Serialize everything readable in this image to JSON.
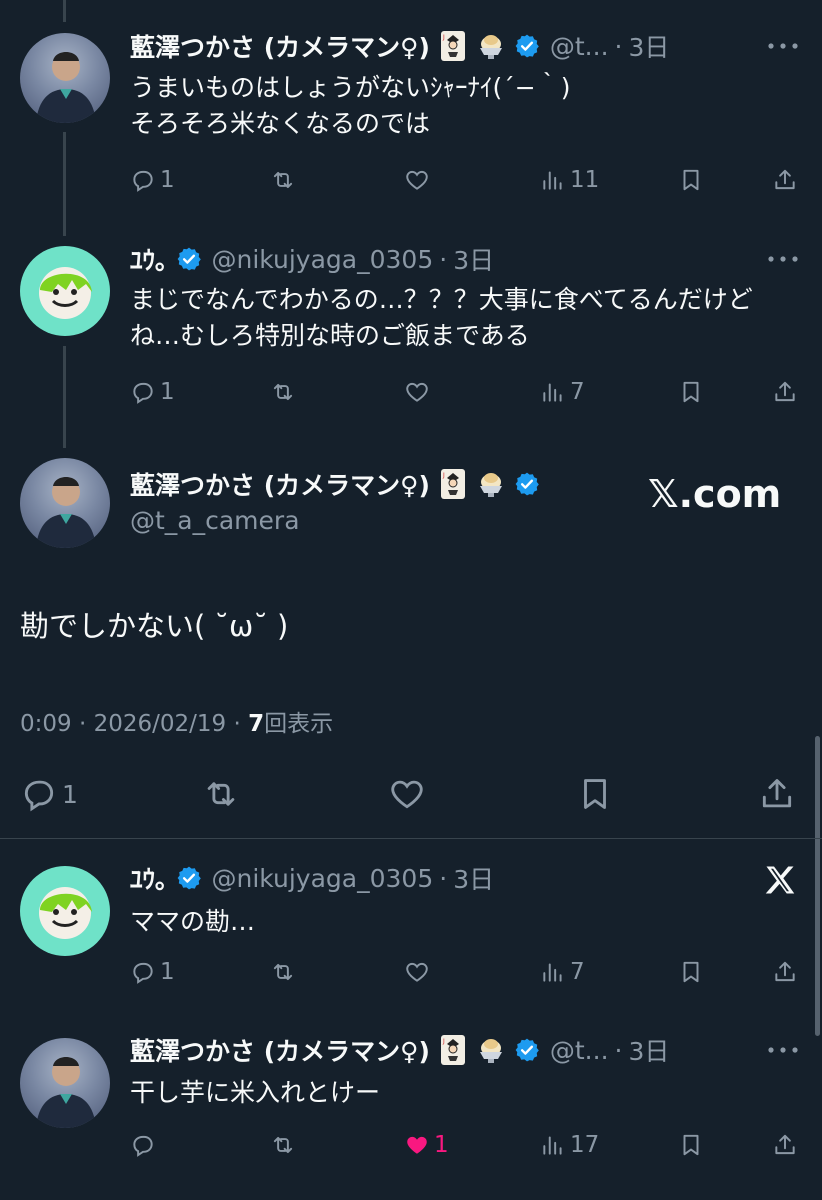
{
  "colors": {
    "background": "#15202b",
    "text": "#f7f9f9",
    "muted": "#8b98a5",
    "verified": "#1d9bf0",
    "like": "#f91880",
    "divider": "#38444d"
  },
  "tweets": [
    {
      "name": "藍澤つかさ (カメラマン♀)",
      "handle": "@t...",
      "time": "3日",
      "text": "うまいものはしょうがないｼｬｰﾅｲ(´−｀)\nそろそろ米なくなるのでは",
      "replies": "1",
      "retweets": "",
      "likes": "",
      "views": "11"
    },
    {
      "name": "ﾕｳ｡",
      "handle": "@nikujyaga_0305",
      "time": "3日",
      "text": "まじでなんでわかるの…？？？大事に食べてるんだけどね…むしろ特別な時のご飯まである",
      "replies": "1",
      "retweets": "",
      "likes": "",
      "views": "7"
    }
  ],
  "main": {
    "name": "藍澤つかさ (カメラマン♀)",
    "handle": "@t_a_camera",
    "watermark": "𝕏.com",
    "text": "勘でしかない( ˘ω˘ )",
    "meta_time": "0:09 · 2026/02/19 · ",
    "meta_views": "7",
    "meta_views_label": "回表示",
    "replies": "1"
  },
  "replies": [
    {
      "name": "ﾕｳ｡",
      "handle": "@nikujyaga_0305",
      "time": "3日",
      "text": "ママの勘…",
      "replies": "1",
      "views": "7"
    },
    {
      "name": "藍澤つかさ (カメラマン♀)",
      "handle": "@t...",
      "time": "3日",
      "text": "干し芋に米入れとけー",
      "replies": "",
      "likes": "1",
      "views": "17"
    }
  ],
  "icons": [
    "reply-icon",
    "retweet-icon",
    "like-icon",
    "views-icon",
    "bookmark-icon",
    "share-icon",
    "verified-icon",
    "more-icon",
    "x-logo-icon",
    "joker-card-emoji",
    "shaved-ice-emoji"
  ]
}
